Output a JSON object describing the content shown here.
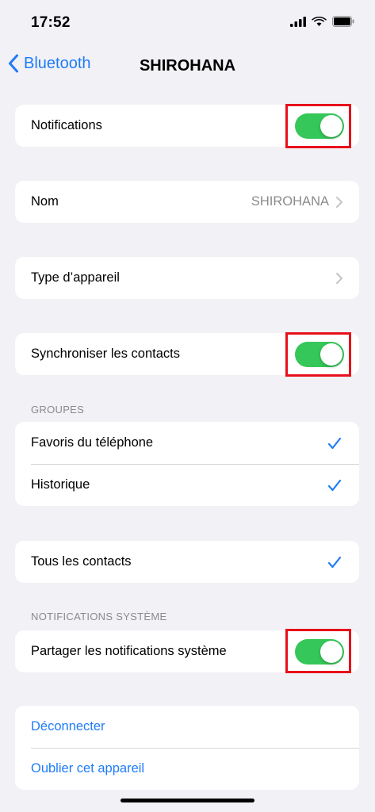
{
  "status_bar": {
    "time": "17:52"
  },
  "nav": {
    "back_label": "Bluetooth",
    "title": "SHIROHANA"
  },
  "notifications": {
    "label": "Notifications",
    "enabled": true
  },
  "name_row": {
    "label": "Nom",
    "value": "SHIROHANA"
  },
  "device_type_row": {
    "label": "Type d’appareil"
  },
  "sync_contacts": {
    "label": "Synchroniser les contacts",
    "enabled": true
  },
  "groups": {
    "header": "GROUPES",
    "items": [
      {
        "label": "Favoris du téléphone",
        "checked": true
      },
      {
        "label": "Historique",
        "checked": true
      }
    ]
  },
  "all_contacts": {
    "label": "Tous les contacts",
    "checked": true
  },
  "system_notifications": {
    "header": "NOTIFICATIONS SYSTÈME",
    "share_label": "Partager les notifications système",
    "enabled": true
  },
  "actions": {
    "disconnect": "Déconnecter",
    "forget": "Oublier cet appareil"
  },
  "colors": {
    "accent": "#1f7cf6",
    "toggle_on": "#35c759",
    "highlight": "#e8101b",
    "background": "#f2f1f6"
  }
}
